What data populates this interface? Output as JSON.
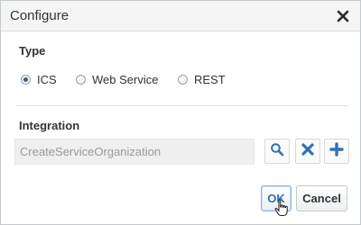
{
  "dialog": {
    "title": "Configure",
    "close_icon": "close-icon"
  },
  "type_section": {
    "label": "Type",
    "options": [
      {
        "label": "ICS",
        "checked": true
      },
      {
        "label": "Web Service",
        "checked": false
      },
      {
        "label": "REST",
        "checked": false
      }
    ]
  },
  "integration_section": {
    "label": "Integration",
    "field_value": "CreateServiceOrganization",
    "actions": {
      "search_icon": "search-icon",
      "clear_icon": "clear-icon",
      "add_icon": "add-icon"
    }
  },
  "buttons": {
    "ok_label": "OK",
    "cancel_label": "Cancel"
  },
  "colors": {
    "accent": "#2f72b7",
    "title_bar": "#f5f5f5",
    "field_background": "#efefef"
  }
}
